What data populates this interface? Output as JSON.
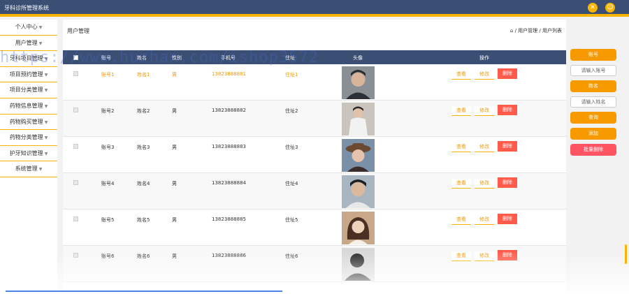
{
  "app": {
    "title": "牙科诊所管理系统"
  },
  "header_icons": [
    "settings-icon",
    "user-icon"
  ],
  "sidebar": {
    "items": [
      {
        "label": "个人中心"
      },
      {
        "label": "用户管理"
      },
      {
        "label": "牙科项目管理"
      },
      {
        "label": "项目预约管理"
      },
      {
        "label": "项目分类管理"
      },
      {
        "label": "药物信息管理"
      },
      {
        "label": "药物购买管理"
      },
      {
        "label": "药物分类管理"
      },
      {
        "label": "护牙知识管理"
      },
      {
        "label": "系统管理"
      }
    ]
  },
  "page": {
    "title": "用户管理",
    "breadcrumb": "/ 用户管理 / 用户列表"
  },
  "table": {
    "headers": [
      "账号",
      "姓名",
      "性别",
      "手机号",
      "住址",
      "头像",
      "操作"
    ],
    "rows": [
      {
        "account": "账号1",
        "name": "姓名1",
        "gender": "男",
        "phone": "13823888881",
        "address": "住址1"
      },
      {
        "account": "账号2",
        "name": "姓名2",
        "gender": "男",
        "phone": "13823888882",
        "address": "住址2"
      },
      {
        "account": "账号3",
        "name": "姓名3",
        "gender": "男",
        "phone": "13823888883",
        "address": "住址3"
      },
      {
        "account": "账号4",
        "name": "姓名4",
        "gender": "男",
        "phone": "13823888884",
        "address": "住址4"
      },
      {
        "account": "账号5",
        "name": "姓名5",
        "gender": "男",
        "phone": "13823888885",
        "address": "住址5"
      },
      {
        "account": "账号6",
        "name": "姓名6",
        "gender": "男",
        "phone": "13823888886",
        "address": "住址6"
      }
    ],
    "actions": {
      "view": "查看",
      "edit": "修改",
      "delete": "删除"
    }
  },
  "search_panel": {
    "account_label": "账号",
    "account_placeholder": "请输入账号",
    "name_label": "姓名",
    "name_placeholder": "请输入姓名",
    "search": "查询",
    "add": "添加",
    "batch_delete": "批量删除"
  },
  "watermark": "https://www.huzhan.com/ishop3572"
}
